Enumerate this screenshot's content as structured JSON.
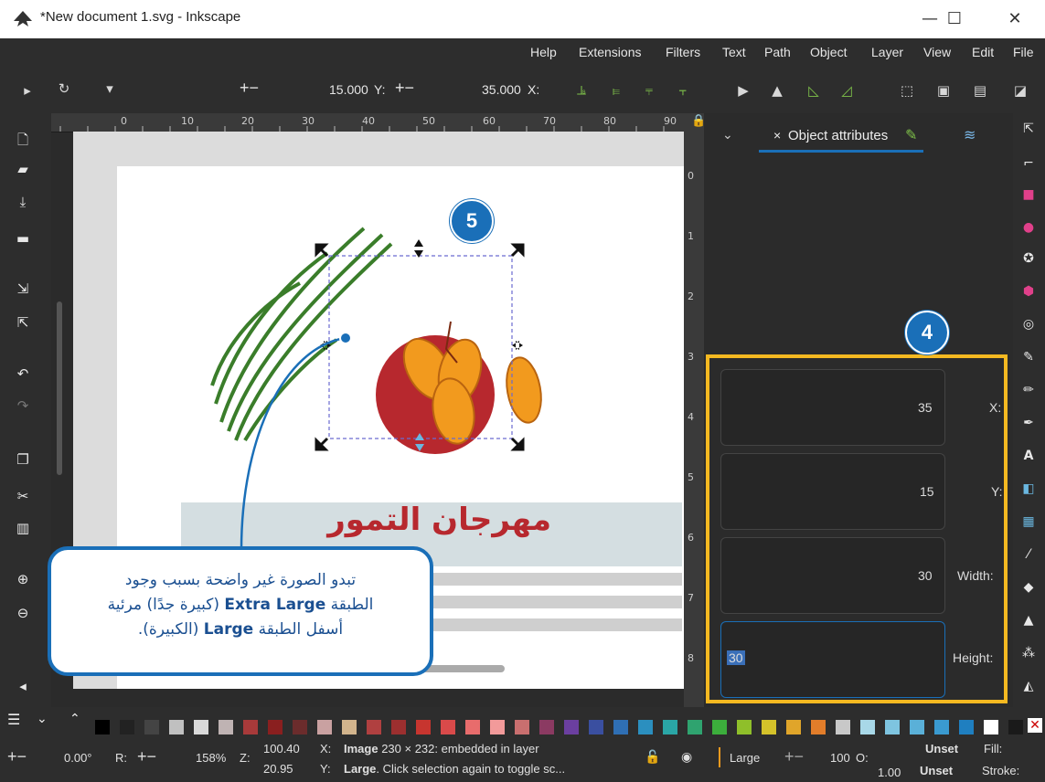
{
  "window": {
    "title": "*New document 1.svg - Inkscape",
    "minimize": "—",
    "maximize": "☐",
    "close": "✕"
  },
  "menu": [
    "Help",
    "Extensions",
    "Filters",
    "Text",
    "Path",
    "Object",
    "Layer",
    "View",
    "Edit",
    "File"
  ],
  "toolbar": {
    "x_value": "15.000",
    "x_label": "Y:",
    "y_value": "35.000",
    "y_label": "X:",
    "plus_minus": "+−"
  },
  "ruler": {
    "ticks": [
      "0",
      "10",
      "20",
      "30",
      "40",
      "50",
      "60",
      "70",
      "80",
      "90"
    ],
    "vticks": [
      "0",
      "1",
      "2",
      "3",
      "4",
      "5",
      "6",
      "7",
      "8"
    ]
  },
  "panel": {
    "tab_label": "Object attributes",
    "fields": [
      {
        "label": "X:",
        "value": "35"
      },
      {
        "label": "Y:",
        "value": "15"
      },
      {
        "label": "Width:",
        "value": "30"
      },
      {
        "label": "Height:",
        "value": "30"
      }
    ]
  },
  "canvas": {
    "heading_text": "مهرجان التمور"
  },
  "badges": {
    "four": "4",
    "five": "5"
  },
  "callout": {
    "line1": "تبدو الصورة غير واضحة بسبب وجود",
    "line2_pre": "الطبقة ",
    "line2_bold": "Extra Large",
    "line2_post": " (كبيرة جدًا) مرئية",
    "line3_pre": "أسفل الطبقة ",
    "line3_bold": "Large",
    "line3_post": " (الكبيرة)."
  },
  "status": {
    "rotation": "0.00°",
    "r_label": "R:",
    "zoom": "158%",
    "z_label": "Z:",
    "coord_x": "100.40",
    "coord_y": "20.95",
    "x_label": "X:",
    "y_label": "Y:",
    "msg1_bold": "Image",
    "msg1_rest": " 230 × 232: embedded in layer",
    "msg2_bold": "Large",
    "msg2_rest": ". Click selection again to toggle sc...",
    "layer": "Large",
    "opacity": "100",
    "o_label": "O:",
    "fill_value": "Unset",
    "fill_label": "Fill:",
    "stroke_value": "Unset",
    "stroke_label": "Stroke:",
    "stroke_width": "1.00"
  },
  "colors": {
    "accent_blue": "#1a6fb8",
    "highlight_yellow": "#f5b921",
    "brand_red": "#b7282e",
    "date_orange": "#f29a1e",
    "leaf_green": "#3a7d2a"
  },
  "palette": [
    "#000000",
    "#222222",
    "#444444",
    "#c0c0c0",
    "#d9d9d9",
    "#bfb3b3",
    "#a83a3a",
    "#8a1f1f",
    "#6b2c2c",
    "#c9a1a1",
    "#d2b48c",
    "#b04040",
    "#9c2f2f",
    "#c7352f",
    "#d94a4a",
    "#e86c6c",
    "#f29a9a",
    "#c96f6f",
    "#8b3a62",
    "#6b3fa0",
    "#3a4fa0",
    "#2f6fb4",
    "#2b8fbf",
    "#2aa6a6",
    "#2fa36f",
    "#3cae3c",
    "#8fbf2a",
    "#d4c22a",
    "#e0a52a",
    "#e27d2a",
    "#c8c8c8",
    "#a8d8e8",
    "#7ec4e0",
    "#5ab0d8",
    "#3a9ad0",
    "#1f7fc0",
    "#ffffff",
    "#1a1a1a"
  ]
}
